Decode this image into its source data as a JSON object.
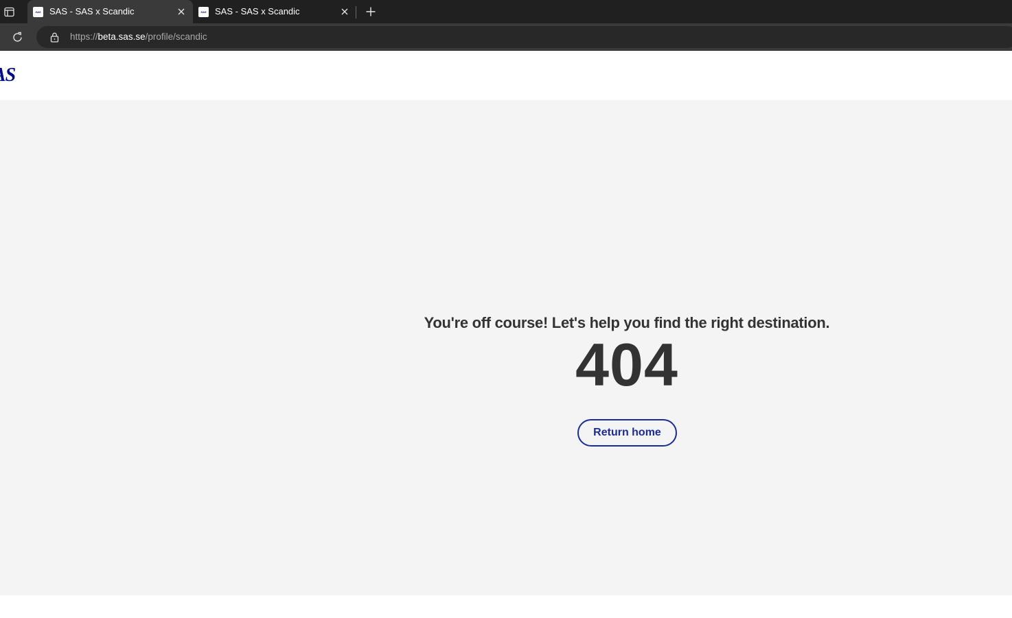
{
  "browser": {
    "tabs": [
      {
        "title": "SAS - SAS x Scandic",
        "favicon_text": "SAS",
        "active": true
      },
      {
        "title": "SAS - SAS x Scandic",
        "favicon_text": "SAS",
        "active": false
      }
    ],
    "url": {
      "scheme": "https://",
      "host": "beta.sas.se",
      "path": "/profile/scandic"
    },
    "icons": {
      "tab_actions": "tab-actions-icon",
      "close": "close-icon",
      "new_tab": "plus-icon",
      "reload": "reload-icon",
      "lock": "lock-icon"
    }
  },
  "site": {
    "logo_text": "AS",
    "brand_color": "#000a8c"
  },
  "error": {
    "headline": "You're off course! Let's help you find the right destination.",
    "code": "404",
    "return_label": "Return home",
    "accent_color": "#1a2b9e"
  }
}
